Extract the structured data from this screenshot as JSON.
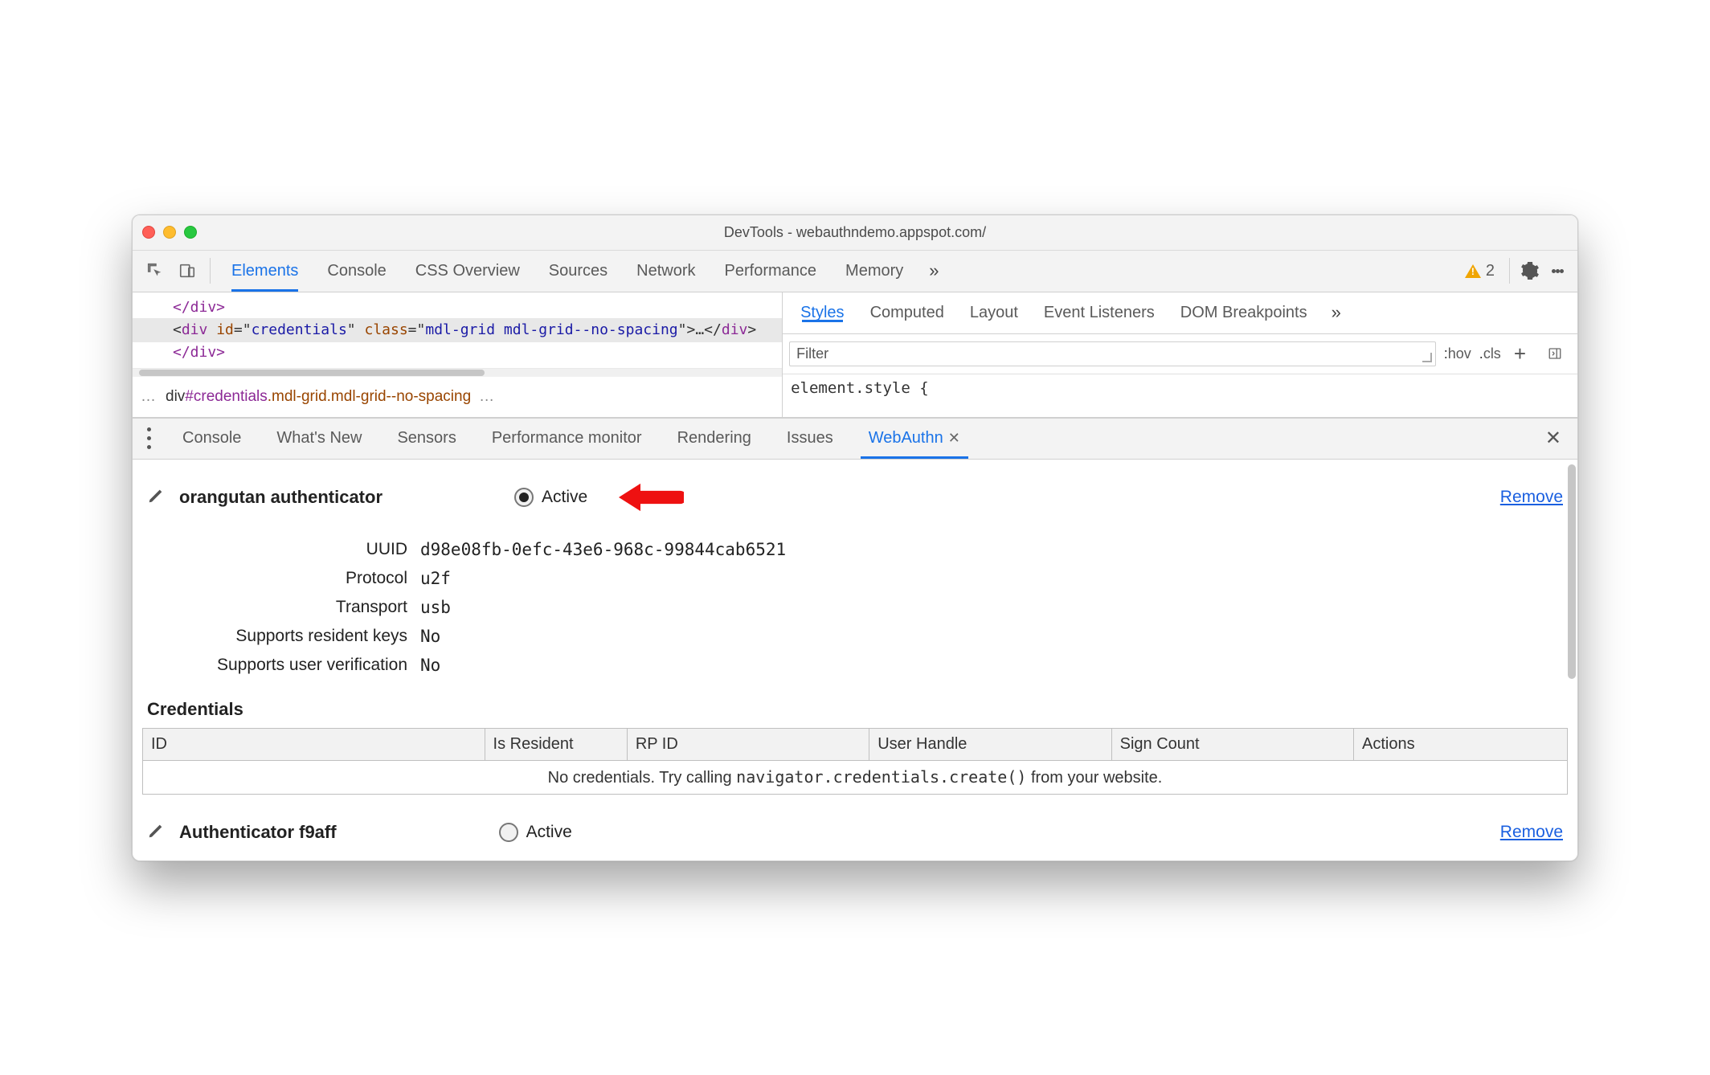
{
  "window_title": "DevTools - webauthndemo.appspot.com/",
  "main_tabs": {
    "elements": "Elements",
    "console": "Console",
    "css_overview": "CSS Overview",
    "sources": "Sources",
    "network": "Network",
    "performance": "Performance",
    "memory": "Memory",
    "more": "»"
  },
  "warnings_count": "2",
  "dom": {
    "line1": "</div>",
    "line2_open_tag": "div",
    "line2_attr_id_name": "id",
    "line2_attr_id_val": "credentials",
    "line2_attr_class_name": "class",
    "line2_attr_class_val": "mdl-grid mdl-grid--no-spacing",
    "line2_ellipsis": "…",
    "line2_close": "</div>",
    "line3": "</div>"
  },
  "breadcrumb": {
    "prefix": "…",
    "seg_tag": "div",
    "seg_id": "#credentials",
    "seg_cls1": ".mdl-grid",
    "seg_cls2": ".mdl-grid--no-spacing",
    "suffix": "…"
  },
  "styles_tabs": {
    "styles": "Styles",
    "computed": "Computed",
    "layout": "Layout",
    "event_listeners": "Event Listeners",
    "dom_breakpoints": "DOM Breakpoints",
    "more": "»"
  },
  "filter_placeholder": "Filter",
  "hov_label": "hov",
  "cls_label": "cls",
  "style_body": "element.style {",
  "drawer_tabs": {
    "console": "Console",
    "whats_new": "What's New",
    "sensors": "Sensors",
    "perf_monitor": "Performance monitor",
    "rendering": "Rendering",
    "issues": "Issues",
    "webauthn": "WebAuthn"
  },
  "auth1": {
    "name": "orangutan authenticator",
    "active_label": "Active",
    "remove": "Remove",
    "kv": {
      "uuid_k": "UUID",
      "uuid_v": "d98e08fb-0efc-43e6-968c-99844cab6521",
      "protocol_k": "Protocol",
      "protocol_v": "u2f",
      "transport_k": "Transport",
      "transport_v": "usb",
      "srk_k": "Supports resident keys",
      "srk_v": "No",
      "suv_k": "Supports user verification",
      "suv_v": "No"
    }
  },
  "credentials": {
    "heading": "Credentials",
    "cols": {
      "id": "ID",
      "is_resident": "Is Resident",
      "rp_id": "RP ID",
      "user_handle": "User Handle",
      "sign_count": "Sign Count",
      "actions": "Actions"
    },
    "empty_pre": "No credentials. Try calling ",
    "empty_code": "navigator.credentials.create()",
    "empty_post": " from your website."
  },
  "auth2": {
    "name": "Authenticator f9aff",
    "active_label": "Active",
    "remove": "Remove"
  }
}
